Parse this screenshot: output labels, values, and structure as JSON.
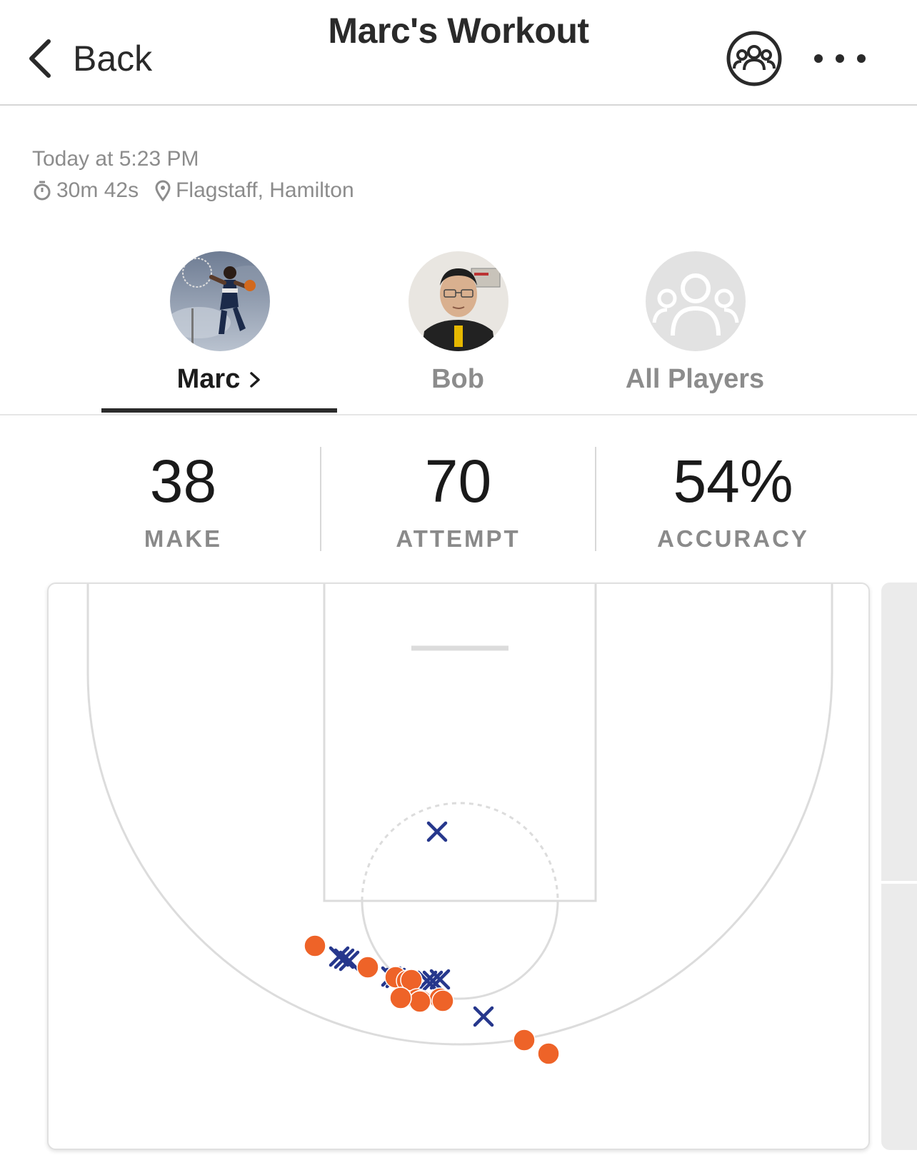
{
  "header": {
    "back_label": "Back",
    "title": "Marc's Workout",
    "group_icon": "group-icon",
    "more_icon": "more-icon"
  },
  "meta": {
    "date": "Today at 5:23 PM",
    "duration": "30m 42s",
    "location": "Flagstaff, Hamilton"
  },
  "players": [
    {
      "name": "Marc",
      "active": true
    },
    {
      "name": "Bob",
      "active": false
    },
    {
      "name": "All Players",
      "active": false
    }
  ],
  "stats": {
    "make_value": "38",
    "make_label": "MAKE",
    "attempt_value": "70",
    "attempt_label": "ATTEMPT",
    "accuracy_value": "54%",
    "accuracy_label": "ACCURACY"
  },
  "colors": {
    "make": "#EE6328",
    "miss": "#26378C",
    "court_lines": "#DCDCDC"
  },
  "shot_legend": {
    "make_marker": "filled-circle",
    "miss_marker": "x-mark"
  }
}
